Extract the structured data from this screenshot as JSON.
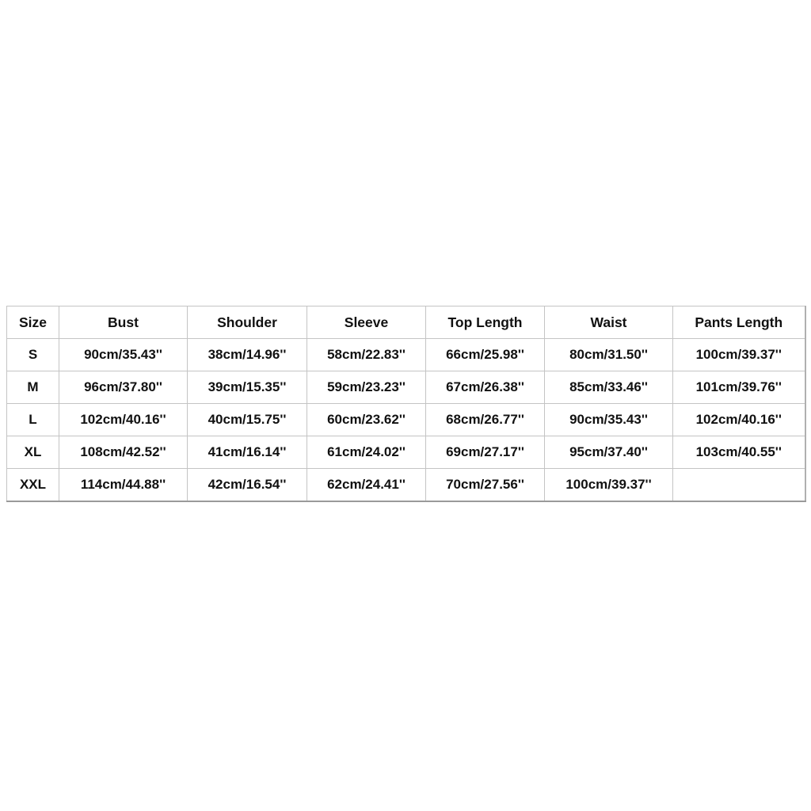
{
  "size_chart": {
    "headers": [
      "Size",
      "Bust",
      "Shoulder",
      "Sleeve",
      "Top Length",
      "Waist",
      "Pants Length"
    ],
    "rows": [
      [
        "S",
        "90cm/35.43''",
        "38cm/14.96''",
        "58cm/22.83''",
        "66cm/25.98''",
        "80cm/31.50''",
        "100cm/39.37''"
      ],
      [
        "M",
        "96cm/37.80''",
        "39cm/15.35''",
        "59cm/23.23''",
        "67cm/26.38''",
        "85cm/33.46''",
        "101cm/39.76''"
      ],
      [
        "L",
        "102cm/40.16''",
        "40cm/15.75''",
        "60cm/23.62''",
        "68cm/26.77''",
        "90cm/35.43''",
        "102cm/40.16''"
      ],
      [
        "XL",
        "108cm/42.52''",
        "41cm/16.14''",
        "61cm/24.02''",
        "69cm/27.17''",
        "95cm/37.40''",
        "103cm/40.55''"
      ],
      [
        "XXL",
        "114cm/44.88''",
        "42cm/16.54''",
        "62cm/24.41''",
        "70cm/27.56''",
        "100cm/39.37''",
        ""
      ]
    ]
  }
}
